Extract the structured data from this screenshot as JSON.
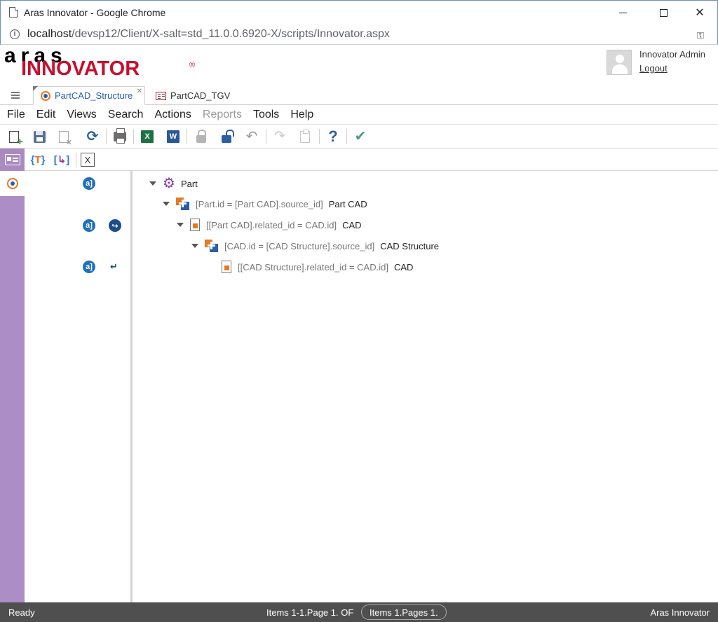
{
  "browser": {
    "window_title": "Aras Innovator - Google Chrome",
    "url_host": "localhost",
    "url_path": "/devsp12/Client/X-salt=std_11.0.0.6920-X/scripts/Innovator.aspx"
  },
  "header": {
    "logo_top": "aras",
    "logo_bottom": "INNOVATOR",
    "logo_reg": "®",
    "user_name": "Innovator Admin",
    "logout_label": "Logout"
  },
  "tabs": [
    {
      "label": "PartCAD_Structure",
      "active": true,
      "close": "✕"
    },
    {
      "label": "PartCAD_TGV",
      "active": false
    }
  ],
  "menu": [
    "File",
    "Edit",
    "Views",
    "Search",
    "Actions",
    "Reports",
    "Tools",
    "Help"
  ],
  "menu_disabled": [
    "Reports"
  ],
  "toolbar": {
    "excel_letter": "X",
    "word_letter": "W",
    "refresh_glyph": "⟳",
    "undo_glyph": "↶",
    "redo_glyph": "↷",
    "help_glyph": "?",
    "check_glyph": "✔"
  },
  "query_bar": {
    "curly_left": "{",
    "curly_mid": "T",
    "curly_right": "}",
    "bracket_left": "[",
    "bracket_mid": "↳",
    "bracket_right": "]",
    "x_glyph": "X"
  },
  "mid_panel": {
    "badge_glyph": "a]",
    "link_glyph": "↪",
    "return_glyph": "↵"
  },
  "tree": [
    {
      "level": 0,
      "icon": "gear-icon",
      "condition": "",
      "label": "Part"
    },
    {
      "level": 1,
      "icon": "join-icon",
      "condition": "[Part.id = [Part CAD].source_id]",
      "label": "Part CAD"
    },
    {
      "level": 2,
      "icon": "ref-icon",
      "condition": "[[Part CAD].related_id = CAD.id]",
      "label": "CAD"
    },
    {
      "level": 3,
      "icon": "join-icon",
      "condition": "[CAD.id = [CAD Structure].source_id]",
      "label": "CAD Structure"
    },
    {
      "level": 4,
      "icon": "ref-icon",
      "condition": "[[CAD Structure].related_id = CAD.id]",
      "label": "CAD"
    }
  ],
  "status": {
    "ready": "Ready",
    "items": "Items 1-1.Page 1. OF",
    "pages": "Items 1.Pages 1.",
    "brand": "Aras Innovator"
  },
  "colors": {
    "accent_purple": "#ad8dc6",
    "brand_red": "#c8102e",
    "link_blue": "#2b5ea7",
    "status_bg": "#4f4f4f"
  }
}
